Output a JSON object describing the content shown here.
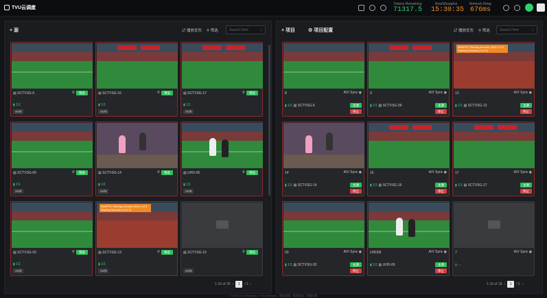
{
  "app": {
    "title": "TVU云调度"
  },
  "stats": [
    {
      "label": "Tokens Remaining",
      "value": "71317.5"
    },
    {
      "label": "Asia/Shanghai",
      "value": "15:30:35"
    },
    {
      "label": "Network Delay",
      "value": "676ms"
    }
  ],
  "sources": {
    "title": "+ 源",
    "broadcast_label": "播放优先",
    "filter_label": "筛选",
    "search_placeholder": "Search Here",
    "pagination": {
      "range": "1-15 of 29",
      "current": "1",
      "total": "/ 2"
    },
    "cards": [
      {
        "name": "SCTVSG-6",
        "btn": "预览",
        "sub": "1/1",
        "tag": "AV/8"
      },
      {
        "name": "SCTVSG-16",
        "btn": "预览",
        "sub": "1/1",
        "tag": "AV/8"
      },
      {
        "name": "SCTVSG-17",
        "btn": "预览",
        "sub": "1/1",
        "tag": "AV/8"
      },
      {
        "name": "SCTVSG-09",
        "btn": "预览",
        "sub": "1/1",
        "tag": "AV/8"
      },
      {
        "name": "SCTVSG-14",
        "btn": "预览",
        "sub": "1/1",
        "tag": "AV/8"
      },
      {
        "name": "UHD-06",
        "btn": "预览",
        "sub": "1/1",
        "tag": "AV/8"
      },
      {
        "name": "SCTVSG-03",
        "btn": "预览",
        "sub": "1/1",
        "tag": "AV/8"
      },
      {
        "name": "SCTVSG-13",
        "btn": "预览",
        "sub": "1/1",
        "tag": "AV/8"
      },
      {
        "name": "SCTVSG-15",
        "btn": "预览",
        "sub": "",
        "tag": "AV/8"
      }
    ]
  },
  "projects": {
    "title": "+ 项目",
    "config_label": "项目配置",
    "broadcast_label": "播放优先",
    "filter_label": "筛选",
    "search_placeholder": "Search Here",
    "pagination": {
      "range": "1-15 of 18",
      "current": "1",
      "total": "/ 2"
    },
    "cards": [
      {
        "num": "8",
        "sync": "A/V Sync",
        "src": "SCTVSG-6",
        "main": "主源",
        "stop": "停止"
      },
      {
        "num": "9",
        "sync": "A/V Sync",
        "src": "SCTVSG-09",
        "main": "主源",
        "stop": "停止"
      },
      {
        "num": "13",
        "sync": "A/V Sync",
        "src": "SCTVSG-13",
        "main": "主源",
        "stop": "停止",
        "err": "WebRTC Starting decoder (5/6) 2 of 3. Starting Decoder (3 of 3)"
      },
      {
        "num": "14",
        "sync": "A/V Sync",
        "src": "SCTVSG-14",
        "main": "主源",
        "stop": "停止"
      },
      {
        "num": "16",
        "sync": "A/V Sync",
        "src": "SCTVSG-16",
        "main": "主源",
        "stop": "停止"
      },
      {
        "num": "17",
        "sync": "A/V Sync",
        "src": "SCTVSG-17",
        "main": "主源",
        "stop": "停止"
      },
      {
        "num": "03",
        "sync": "A/V Sync",
        "src": "SCTVSG-03",
        "main": "主源",
        "stop": "停止"
      },
      {
        "num": "UHD06",
        "sync": "A/V Sync",
        "src": "UHD-06",
        "main": "主源",
        "stop": "停止"
      },
      {
        "num": "7",
        "sync": "A/V Sync",
        "src": "",
        "main": "",
        "stop": ""
      }
    ]
  },
  "source_err": "WebRTC Starting decoder (5/6) 2 of 3. Starting Decoder (3 of 3)",
  "footer": "© 2023 TVU Networks · TVU Networks · 隐私政策 · 服务协议 · 问题反馈"
}
